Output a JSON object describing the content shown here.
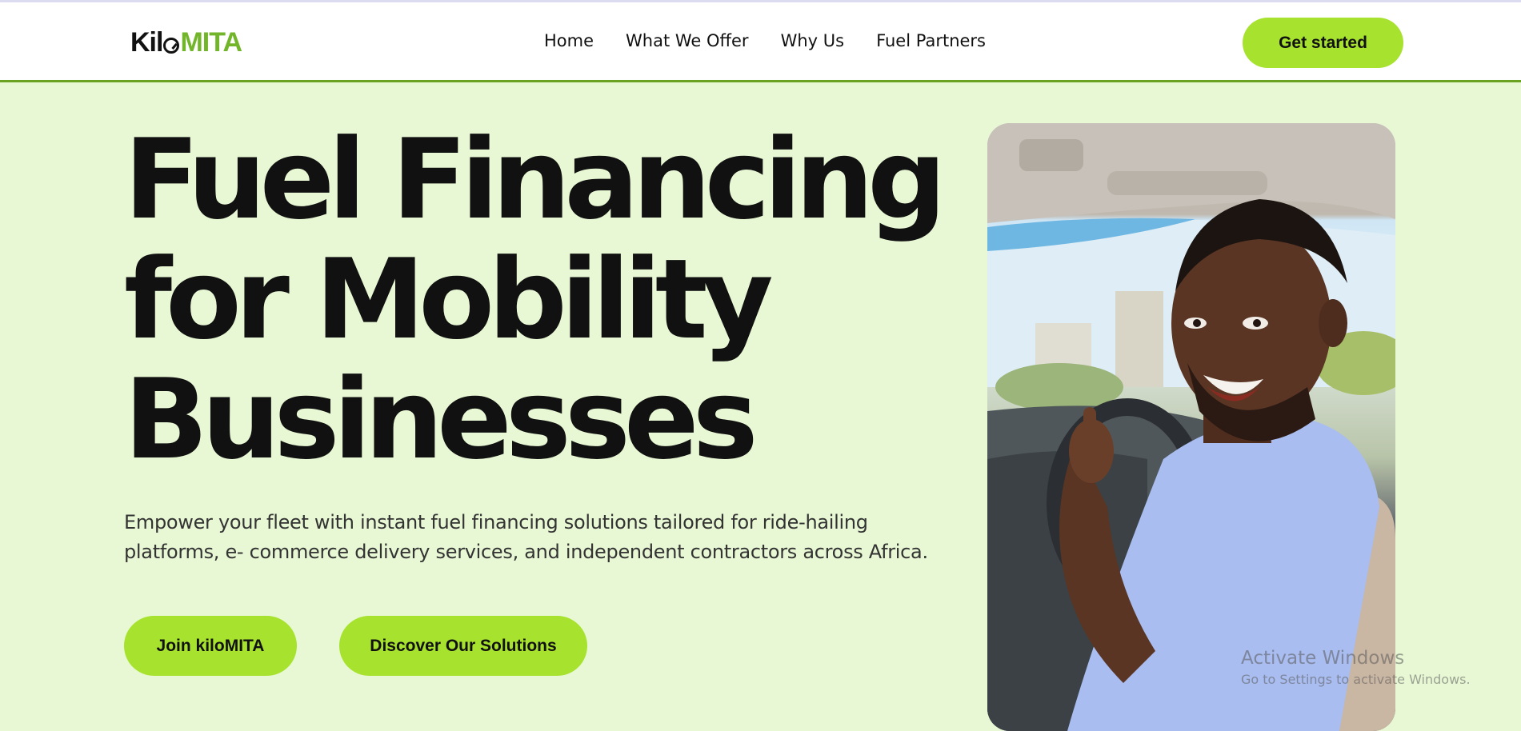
{
  "header": {
    "logo": {
      "part1": "Kil",
      "part2": "MITA"
    },
    "nav": [
      "Home",
      "What We Offer",
      "Why Us",
      "Fuel Partners"
    ],
    "cta_label": "Get started"
  },
  "hero": {
    "title_lines": [
      "Fuel Financing",
      "for Mobility",
      "Businesses"
    ],
    "subtitle_line1": "Empower your fleet with instant fuel financing solutions tailored for ride-hailing",
    "subtitle_line2": "platforms, e- commerce delivery services, and independent contractors across Africa.",
    "primary_button": "Join kiloMITA",
    "secondary_button": "Discover Our Solutions"
  },
  "watermark": {
    "line1": "Activate Windows",
    "line2": "Go to Settings to activate Windows."
  },
  "colors": {
    "accent": "#a6e22e",
    "background": "#e8f8d4",
    "logo_green": "#72b52b",
    "header_border": "#6aa322"
  }
}
